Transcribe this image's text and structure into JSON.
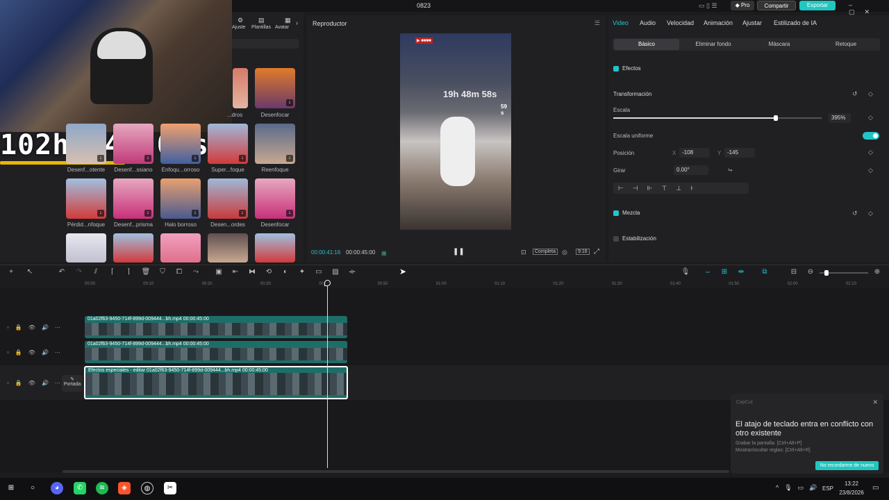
{
  "window": {
    "title": "0823",
    "pro_label": "Pro",
    "share_label": "Compartir",
    "export_label": "Exportar"
  },
  "media_toolbar": {
    "ajuste": "Ajuste",
    "plantillas": "Plantillas",
    "avatar": "Avatar"
  },
  "overlay": {
    "timer": "102h 54m 06s"
  },
  "effects": [
    {
      "label": "Desenf...otente"
    },
    {
      "label": "Desenf...ssiano"
    },
    {
      "label": "Enfoqu...orroso"
    },
    {
      "label": "Super...foque"
    },
    {
      "label": "Reenfoque"
    },
    {
      "label": "Pérdid...nfoque"
    },
    {
      "label": "Desenf...prisma"
    },
    {
      "label": "Halo borroso"
    },
    {
      "label": "Desen...ordes"
    },
    {
      "label": "Desenfocar"
    }
  ],
  "effects_top": {
    "left": "...dros",
    "right": "Desenfocar"
  },
  "player": {
    "title": "Reproductor",
    "current_time": "00:00:41:16",
    "total_time": "00:00:45:00",
    "quality_label": "Completa",
    "ratio_label": "9:16",
    "video_timer": "19h 48m 58s",
    "video_seconds": "59 s"
  },
  "properties": {
    "tabs": [
      "Video",
      "Audio",
      "Velocidad",
      "Animación",
      "Ajustar",
      "Estilizado de IA"
    ],
    "subtabs": [
      "Básico",
      "Eliminar fondo",
      "Máscara",
      "Retoque"
    ],
    "efectos": "Efectos",
    "transformacion": "Transformación",
    "escala": "Escala",
    "escala_value": "395%",
    "escala_level": 0.78,
    "escala_uniforme": "Escala uniforme",
    "posicion": "Posición",
    "pos_x_label": "X",
    "pos_x": "-108",
    "pos_y_label": "Y",
    "pos_y": "-145",
    "girar": "Girar",
    "girar_value": "0.00°",
    "mezcla": "Mezcla",
    "estabilizacion": "Estabilización"
  },
  "timeline": {
    "ruler": [
      "00:00",
      "00:10",
      "00:20",
      "00:30",
      "00:40",
      "00:50",
      "01:00",
      "01:10",
      "01:20",
      "01:30",
      "01:40",
      "01:50",
      "02:00",
      "02:10"
    ],
    "clips": [
      {
        "label": "01a02f63-9450-714f-899d-009444...bh.mp4  00:00:45:00"
      },
      {
        "label": "01a02f63-9450-714f-899d-009444...bh.mp4  00:00:45:00"
      },
      {
        "label": "Efectos especiales - editar   01a02f63-9450-714f-899d-009444...bh.mp4  00:00:45:00"
      }
    ],
    "cover_label": "Portada"
  },
  "notification": {
    "app": "CapCut",
    "title": "El atajo de teclado entra en conflicto con otro existente",
    "line1": "Grabar la pantalla: [Ctrl+Alt+P]",
    "line2": "Mostrar/ocultar reglas: [Ctrl+Alt+R]",
    "button": "No recordarme de nuevo"
  },
  "taskbar": {
    "lang": "ESP",
    "time": "13:22",
    "date": "23/8/2026"
  },
  "colors": {
    "accent": "#22c4c8",
    "clip": "#1e6e68",
    "export": "#1fc7c0"
  }
}
